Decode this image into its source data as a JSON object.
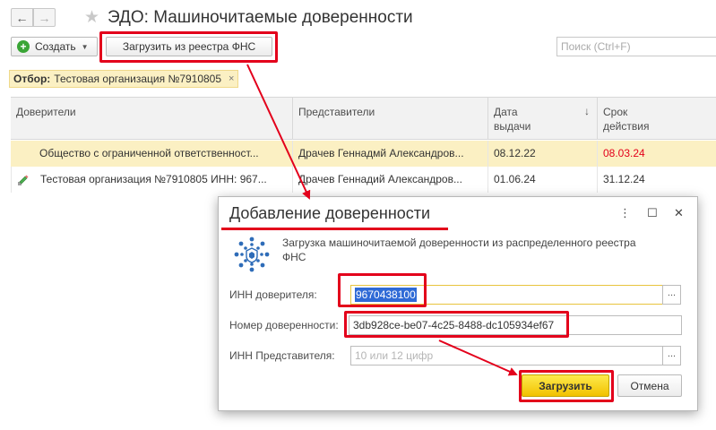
{
  "header": {
    "back_icon": "←",
    "forward_icon": "→",
    "star_icon": "★",
    "title": "ЭДО: Машиночитаемые доверенности"
  },
  "toolbar": {
    "create_label": "Создать",
    "load_label": "Загрузить из реестра ФНС",
    "search_placeholder": "Поиск (Ctrl+F)"
  },
  "filter": {
    "label": "Отбор:",
    "value": "Тестовая организация №7910805",
    "close_icon": "×"
  },
  "table": {
    "columns": [
      "Доверители",
      "Представители",
      "Дата выдачи",
      "Срок действия"
    ],
    "rows": [
      {
        "principal": "Общество с ограниченной ответственност...",
        "representative": "Драчев Геннадмй Александров...",
        "issue_date": "08.12.22",
        "valid_until": "08.03.24",
        "expired": true,
        "selected": true
      },
      {
        "principal": "Тестовая организация №7910805 ИНН: 967...",
        "representative": "Драчев Геннадий Александров...",
        "issue_date": "01.06.24",
        "valid_until": "31.12.24",
        "expired": false,
        "selected": false
      }
    ]
  },
  "dialog": {
    "title": "Добавление доверенности",
    "menu_icon": "⋮",
    "maximize_icon": "☐",
    "close_icon": "✕",
    "description": "Загрузка машиночитаемой доверенности из распределенного реестра ФНС",
    "inn_principal_label": "ИНН доверителя:",
    "inn_principal_value": "9670438100",
    "number_label": "Номер доверенности:",
    "number_value": "3db928ce-be07-4c25-8488-dc105934ef67",
    "inn_rep_label": "ИНН Представителя:",
    "inn_rep_placeholder": "10 или 12 цифр",
    "select_button": "...",
    "load_button": "Загрузить",
    "cancel_button": "Отмена"
  },
  "colors": {
    "highlight": "#e3001b",
    "selected_row": "#fbf0c3",
    "primary_button": "#f7d21f",
    "selection": "#2f6ad6"
  }
}
